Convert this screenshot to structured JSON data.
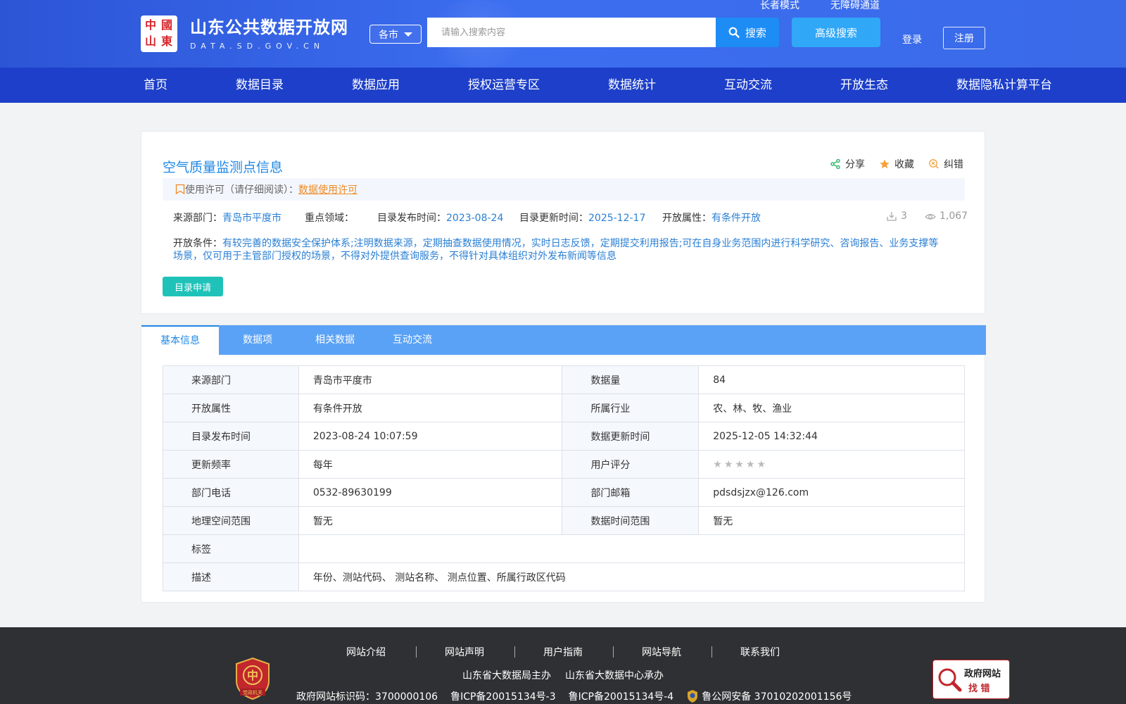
{
  "header": {
    "logo_cells": [
      "中",
      "國",
      "山",
      "東"
    ],
    "site_title": "山东公共数据开放网",
    "site_domain": "DATA.SD.GOV.CN",
    "top_links": [
      "长者模式",
      "无障碍通道"
    ],
    "city_select": "各市",
    "search_placeholder": "请输入搜索内容",
    "search_button": "搜索",
    "advanced_search": "高级搜索",
    "login": "登录",
    "register": "注册"
  },
  "nav": [
    "首页",
    "数据目录",
    "数据应用",
    "授权运营专区",
    "数据统计",
    "互动交流",
    "开放生态",
    "数据隐私计算平台"
  ],
  "dataset": {
    "title": "空气质量监测点信息",
    "actions": {
      "share": "分享",
      "favorite": "收藏",
      "report": "纠错"
    },
    "license_prefix": "使用许可（请仔细阅读）：",
    "license_link": "数据使用许可",
    "source_label": "来源部门：",
    "source_value": "青岛市平度市",
    "focus_label": "重点领域：",
    "focus_value": "",
    "publish_label": "目录发布时间：",
    "publish_value": "2023-08-24",
    "update_label": "目录更新时间：",
    "update_value": "2025-12-17",
    "open_label": "开放属性：",
    "open_value": "有条件开放",
    "downloads": "3",
    "views": "1,067",
    "condition_label": "开放条件：",
    "condition_value": "有较完善的数据安全保护体系;注明数据来源，定期抽查数据使用情况，实时日志反馈，定期提交利用报告;可在自身业务范围内进行科学研究、咨询报告、业务支撑等场景，仅可用于主管部门授权的场景，不得对外提供查询服务，不得针对具体组织对外发布新闻等信息",
    "apply_button": "目录申请"
  },
  "tabs": [
    "基本信息",
    "数据项",
    "相关数据",
    "互动交流"
  ],
  "info_table": {
    "r1": {
      "k1": "来源部门",
      "v1": "青岛市平度市",
      "k2": "数据量",
      "v2": "84"
    },
    "r2": {
      "k1": "开放属性",
      "v1": "有条件开放",
      "k2": "所属行业",
      "v2": "农、林、牧、渔业"
    },
    "r3": {
      "k1": "目录发布时间",
      "v1": "2023-08-24 10:07:59",
      "k2": "数据更新时间",
      "v2": "2025-12-05 14:32:44"
    },
    "r4": {
      "k1": "更新频率",
      "v1": "每年",
      "k2": "用户评分",
      "rating": 0
    },
    "r5": {
      "k1": "部门电话",
      "v1": "0532-89630199",
      "k2": "部门邮箱",
      "v2": "pdsdsjzx@126.com"
    },
    "r6": {
      "k1": "地理空间范围",
      "v1": "暂无",
      "k2": "数据时间范围",
      "v2": "暂无"
    },
    "r7": {
      "k1": "标签",
      "v1": ""
    },
    "r8": {
      "k1": "描述",
      "v1": "年份、测站代码、 测站名称、 测点位置、所属行政区代码"
    }
  },
  "footer": {
    "links": [
      "网站介绍",
      "网站声明",
      "用户指南",
      "网站导航",
      "联系我们"
    ],
    "sponsor": "山东省大数据局主办",
    "organizer": "山东省大数据中心承办",
    "gov_id": "政府网站标识码：3700000106",
    "icp1": "鲁ICP备20015134号-3",
    "icp2": "鲁ICP备20015134号-4",
    "police": "鲁公网安备 37010202001156号",
    "party_badge_text": "党政机关",
    "find_error_title": "政府网站",
    "find_error_sub": "找 错"
  },
  "colors": {
    "header_blue": "#3c6ef0",
    "nav_blue": "#1d3fc9",
    "link_blue": "#1e88e5",
    "apply_teal": "#1fc2b8",
    "license_orange": "#f08a24"
  }
}
